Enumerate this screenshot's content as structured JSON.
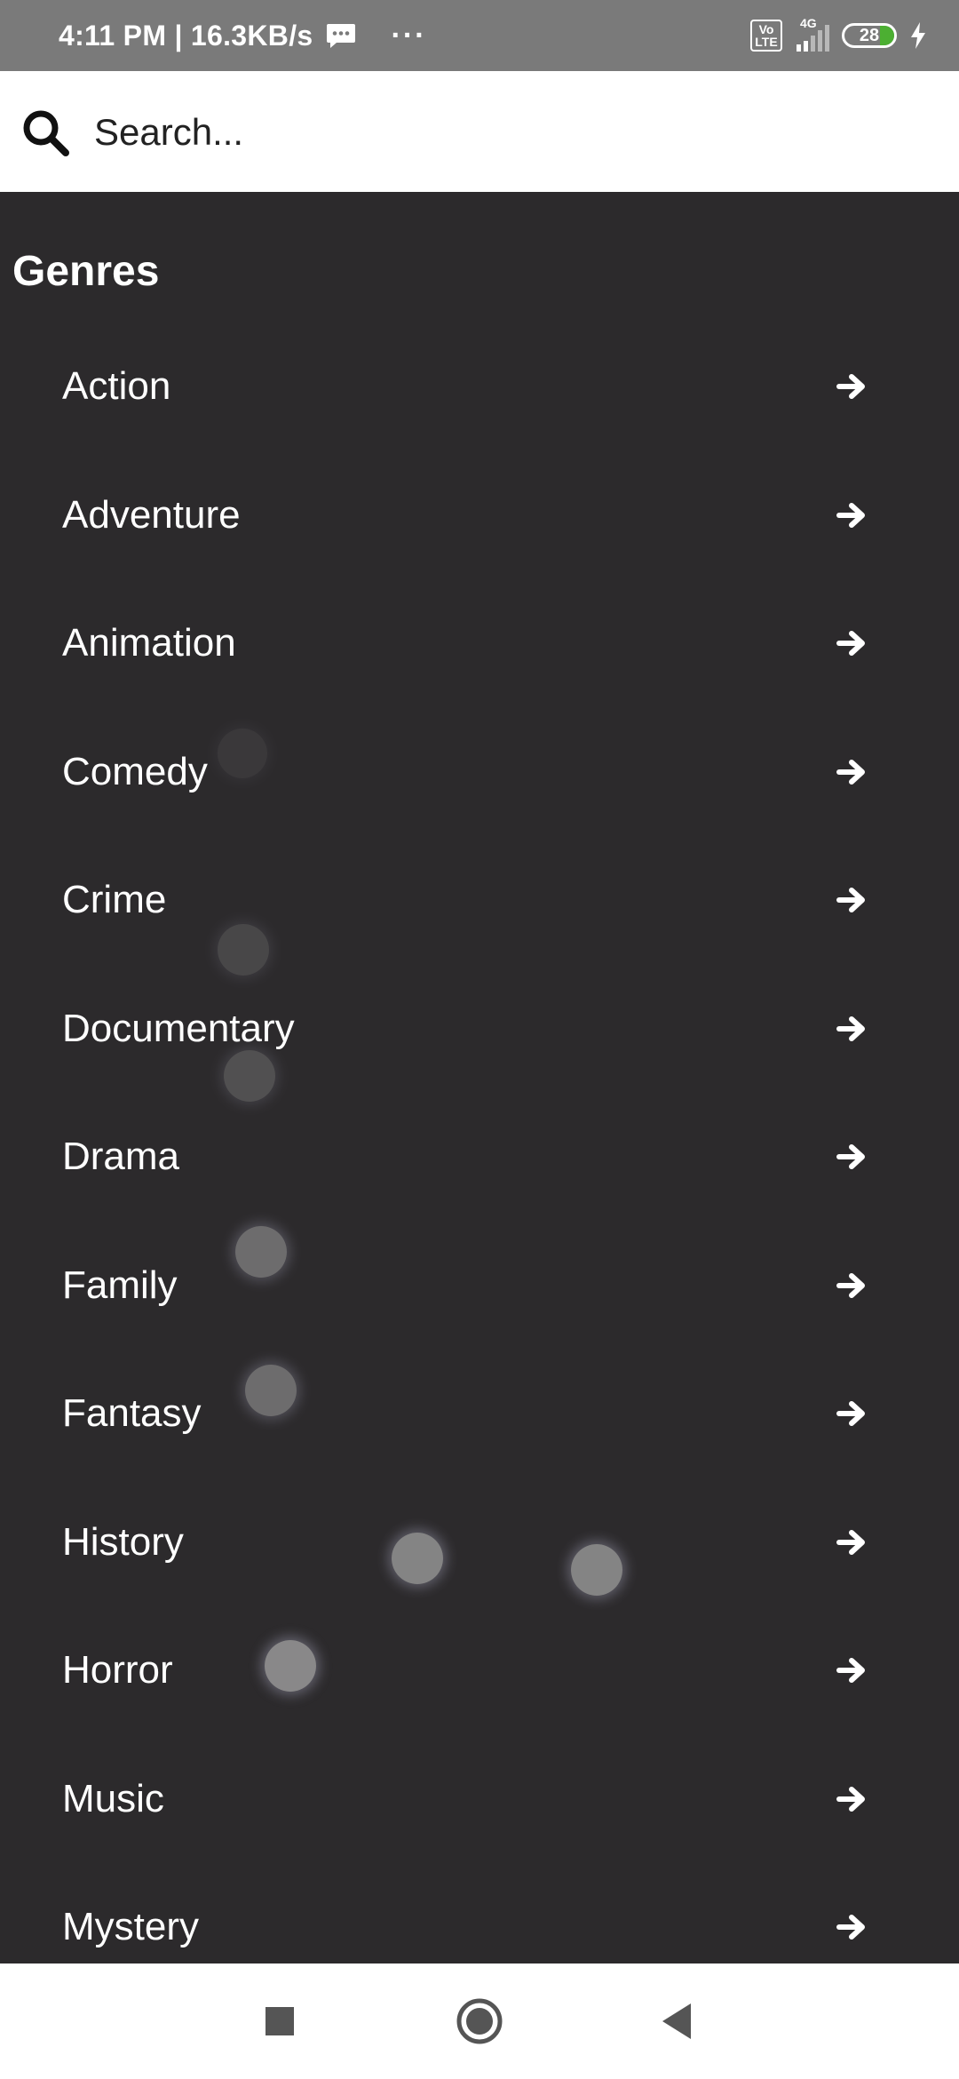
{
  "status_bar": {
    "time_speed": "4:11 PM | 16.3KB/s",
    "more": "···",
    "network": "4G",
    "volte": "Vo LTE",
    "battery": "28"
  },
  "search": {
    "placeholder": "Search..."
  },
  "section_title": "Genres",
  "genres": [
    "Action",
    "Adventure",
    "Animation",
    "Comedy",
    "Crime",
    "Documentary",
    "Drama",
    "Family",
    "Fantasy",
    "History",
    "Horror",
    "Music",
    "Mystery"
  ]
}
